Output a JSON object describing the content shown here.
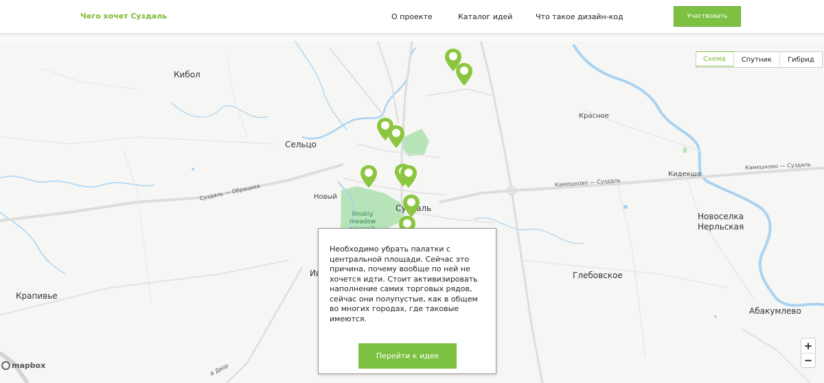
{
  "header": {
    "brand": "Чего хочет Суздаль",
    "nav": [
      "О проекте",
      "Каталог идей",
      "Что такое дизайн-код"
    ],
    "cta_label": "Участвовать"
  },
  "map": {
    "map_types": [
      "Схема",
      "Спутник",
      "Гибрид"
    ],
    "active_map_type": "Схема",
    "zoom_in": "+",
    "zoom_out": "−",
    "attribution": "mapbox",
    "places": {
      "kibol": "Кибол",
      "seltso": "Сельцо",
      "krasnoe": "Красное",
      "kideksha": "Кидекша",
      "noviy": "Новый",
      "suzdal": "Суздаль",
      "novoselka": "Новоселка",
      "nerlskaya": "Нерльская",
      "iv": "Ив",
      "krapivye": "Крапивье",
      "glebovskoe": "Глебовское",
      "abakumlevo": "Абакумлево"
    },
    "roads": {
      "suzdal_obratsikha": "Суздаль — Обрациха",
      "kameshkovo_suzdal_1": "Камешково — Суздаль",
      "kameshkovo_suzdal_2": "Камешково — Суздаль",
      "dvor": "й Двор"
    },
    "park_label": "Ilinskiy meadow zakaznik",
    "pin_color": "#8cc63f"
  },
  "popup": {
    "text": "Необходимо убрать палатки с центральной площади. Сейчас это причина, почему вообще по ней не хочется идти. Стоит активизировать наполнение самих торговых рядов, сейчас они полупустые, как в общем во многих городах, где таковые имеются.",
    "button_label": "Перейти к идее"
  }
}
